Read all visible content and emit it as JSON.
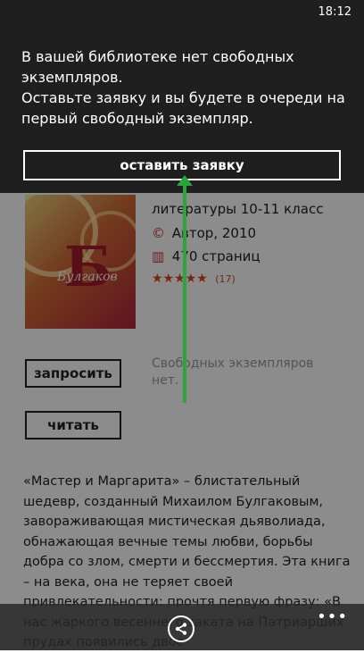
{
  "status_bar": {
    "time": "18:12"
  },
  "dialog": {
    "line1": "В вашей библиотеке нет свободных экземпляров.",
    "line2": "Оставьте заявку и вы будете в очереди на первый свободный экземпляр.",
    "button_label": "оставить заявку"
  },
  "book": {
    "subtitle": "литературы 10-11 класс",
    "author_year": "Автор, 2010",
    "pages": "470 страниц",
    "rating_stars": "★★★★★",
    "rating_count": "(17)",
    "cover_big": "Б",
    "cover_small": "Булгаков"
  },
  "actions": {
    "request_label": "запросить",
    "read_label": "читать",
    "availability": "Свободных экземпляров нет."
  },
  "description": "«Мастер и Маргарита» – блистательный шедевр, созданный Михаилом Булгаковым, завораживающая мистическая дьяволиада, обнажающая вечные темы любви, борьбы добра со злом, смерти и бессмертия. Эта книга – на века, она не теряет своей привлекательности: прочтя первую фразу: «В нас жаркого весеннего заката на Патриарших прудах появились двое",
  "appbar": {
    "more": "•••"
  },
  "colors": {
    "arrow": "#2aa53a",
    "dialog_bg": "#1f1f1f",
    "stars": "#d14a1c"
  }
}
